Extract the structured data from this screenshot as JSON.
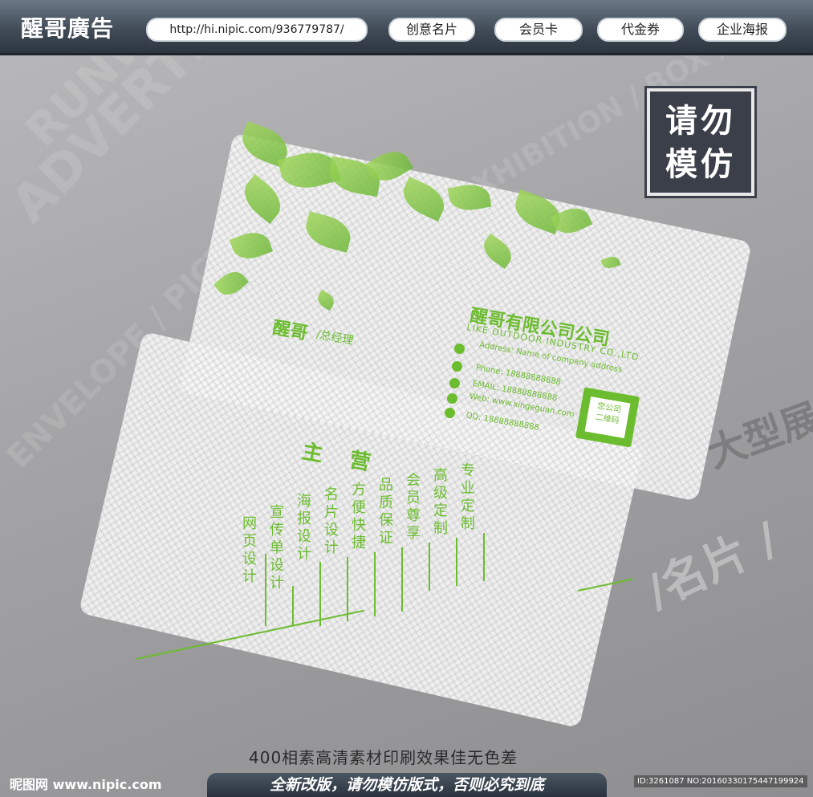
{
  "header": {
    "logo": "醒哥廣告",
    "url": "http://hi.nipic.com/936779787/",
    "nav": [
      "创意名片",
      "会员卡",
      "代金券",
      "企业海报"
    ]
  },
  "stamp": {
    "line1": "请勿",
    "line2": "模仿"
  },
  "front_card": {
    "name": "醒哥",
    "title": "/总经理",
    "company": "醒哥有限公司公司",
    "company_en": "LIKE OUTDOOR INDUSTRY CO.,LTD",
    "contacts": [
      "Address: Name of company address",
      "Phone: 18888888888",
      "EMAIL: 18888888888",
      "Web: www.xingeguan.com",
      "QQ: 18888888888"
    ],
    "qr_text": [
      "您公司",
      "二维码"
    ]
  },
  "back_card": {
    "heading": [
      "主",
      "营"
    ],
    "services": [
      "网页设计",
      "宣传单设计",
      "海报设计",
      "名片设计",
      "方便快捷",
      "品质保证",
      "会员尊享",
      "高级定制",
      "专业定制"
    ]
  },
  "background_words": [
    "ADVERTISING",
    "RUNWAY",
    "EXHIBITION / BOX / HOUSE",
    "ENVELOPE / PICTURES",
    "大型展",
    "/名片 /"
  ],
  "caption": "400相素高清素材印刷效果佳无色差",
  "bottom_banner": "全新改版，请勿模仿版式，否则必究到底",
  "watermark": "昵图网 www.nipic.com",
  "image_id": "ID:3261087 NO:20160330175447199924",
  "colors": {
    "accent": "#6cbc2f",
    "header": "#3e4955"
  }
}
